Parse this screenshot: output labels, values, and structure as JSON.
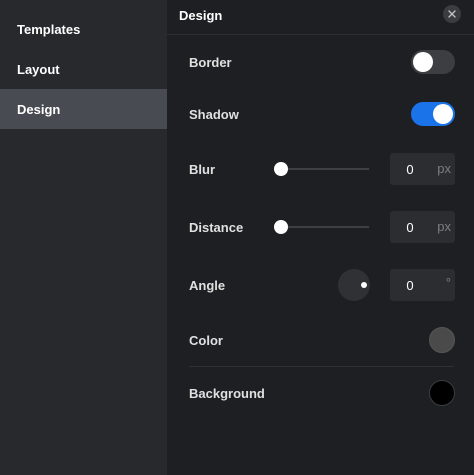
{
  "sidebar": {
    "items": [
      {
        "label": "Templates"
      },
      {
        "label": "Layout"
      },
      {
        "label": "Design"
      }
    ],
    "active": "Design"
  },
  "panel": {
    "title": "Design",
    "border": {
      "label": "Border",
      "enabled": false
    },
    "shadow": {
      "label": "Shadow",
      "enabled": true
    },
    "blur": {
      "label": "Blur",
      "value": "0",
      "unit": "px",
      "slider_level": 0
    },
    "distance": {
      "label": "Distance",
      "value": "0",
      "unit": "px",
      "slider_level": 0
    },
    "angle": {
      "label": "Angle",
      "value": "0",
      "unit": "°"
    },
    "color": {
      "label": "Color",
      "swatch": "#4a4a4a"
    },
    "background": {
      "label": "Background",
      "swatch": "#000000"
    }
  },
  "colors": {
    "accent": "#1a73e8",
    "sidebar_bg": "#27292d",
    "sidebar_active_bg": "#484b51",
    "panel_bg": "#1e1f22"
  },
  "icons": {
    "close": "close-icon"
  }
}
